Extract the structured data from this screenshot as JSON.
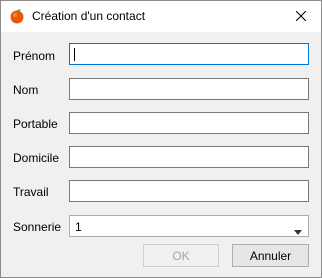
{
  "window": {
    "title": "Création d'un contact",
    "app_icon": "orange-fruit-icon",
    "close_icon": "close-icon"
  },
  "form": {
    "fields": [
      {
        "label": "Prénom",
        "value": "",
        "focused": true
      },
      {
        "label": "Nom",
        "value": ""
      },
      {
        "label": "Portable",
        "value": ""
      },
      {
        "label": "Domicile",
        "value": ""
      },
      {
        "label": "Travail",
        "value": ""
      }
    ],
    "ringtone": {
      "label": "Sonnerie",
      "selected": "1",
      "icon": "chevron-down-icon"
    }
  },
  "buttons": {
    "ok": "OK",
    "cancel": "Annuler"
  },
  "colors": {
    "focus_border": "#0078d7",
    "disabled_text": "#a5a5a5"
  }
}
